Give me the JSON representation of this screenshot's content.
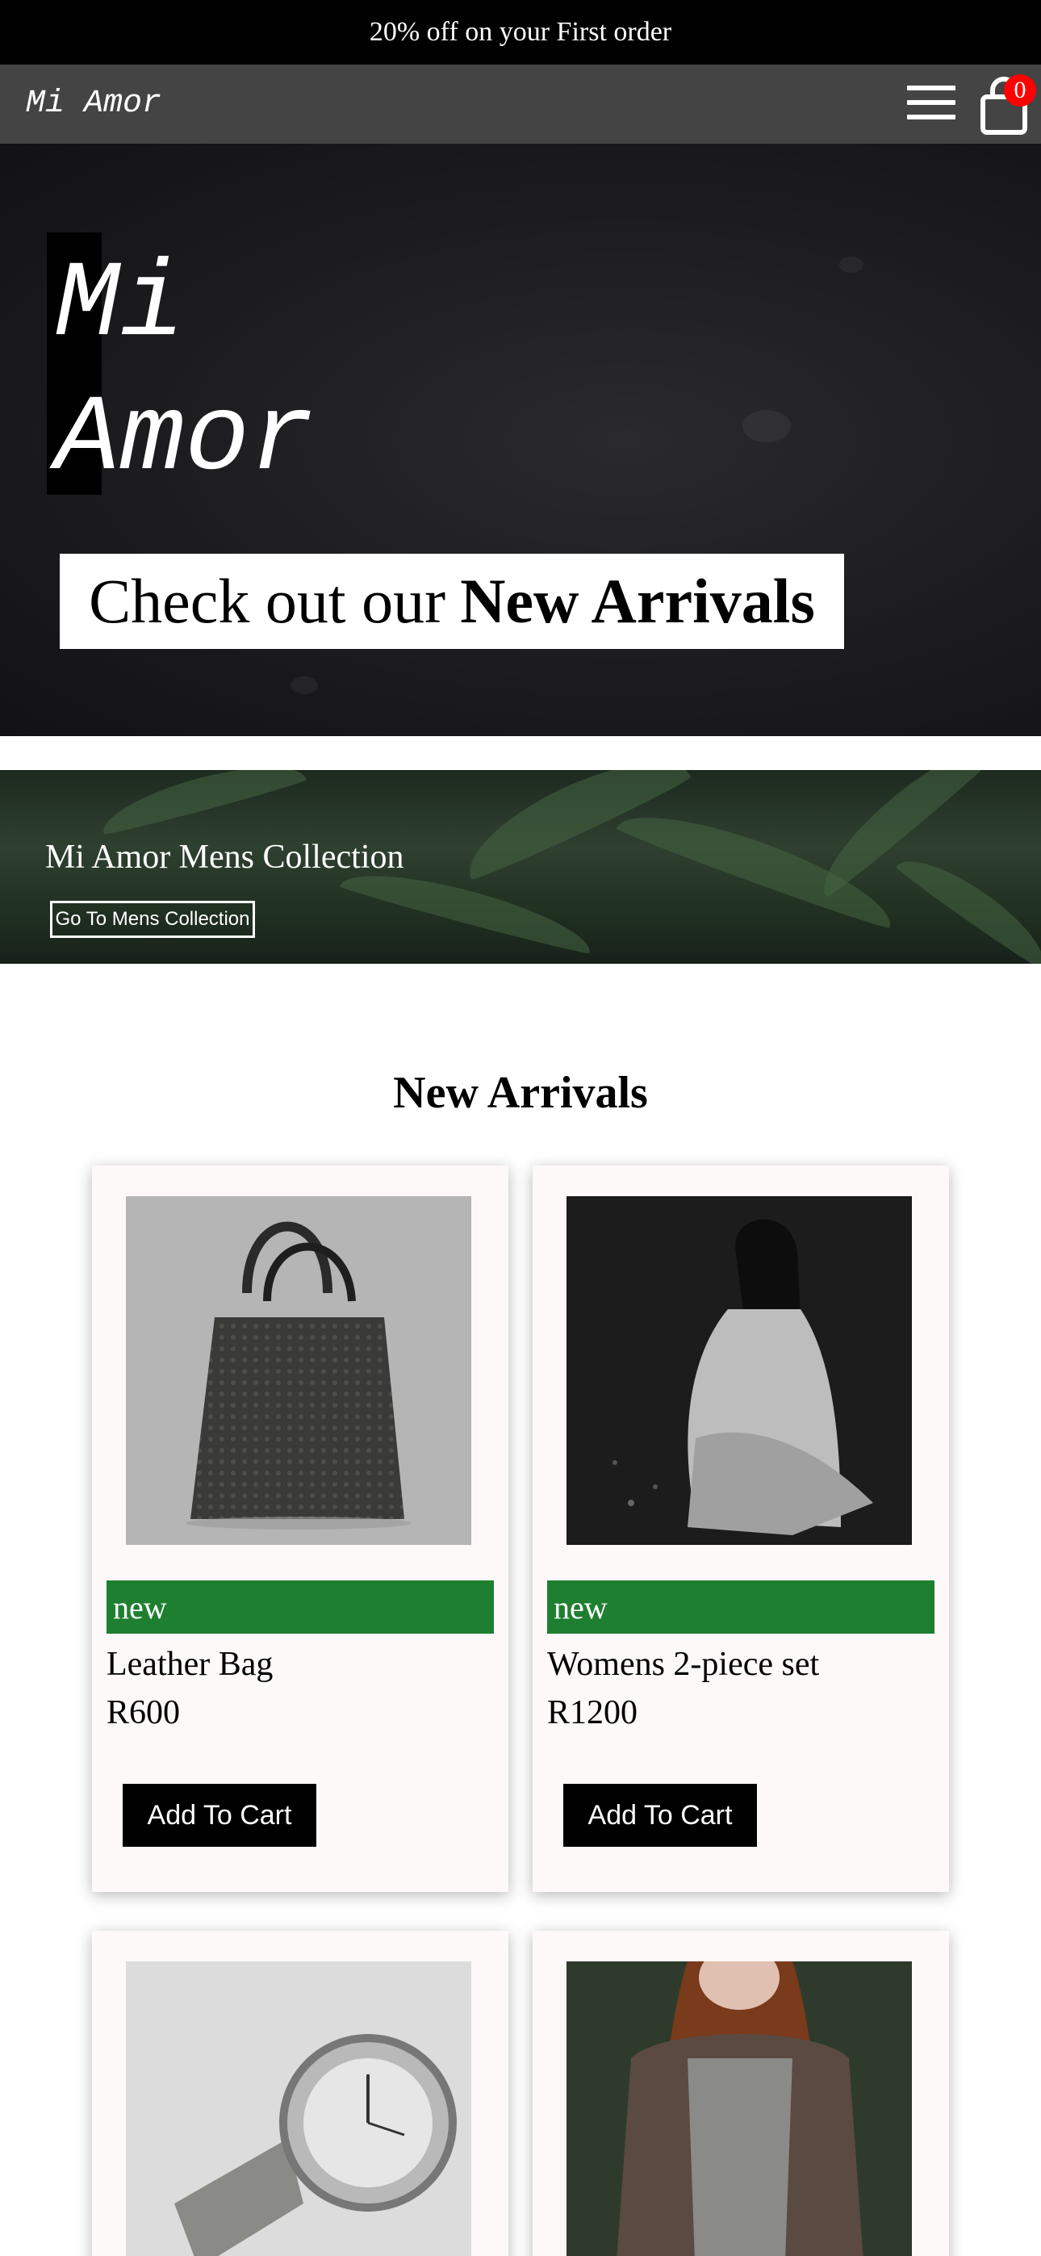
{
  "promo": {
    "text": "20% off on your First order"
  },
  "navbar": {
    "brand": "Mi Amor",
    "cart_count": "0",
    "icons": {
      "menu": "hamburger-menu-icon",
      "cart": "shopping-bag-icon"
    }
  },
  "hero": {
    "title": "Mi\nAmor",
    "cta_prefix": "Check out our",
    "cta_bold": "New Arrivals"
  },
  "mens": {
    "title": "Mi Amor Mens Collection",
    "button_label": "Go To Mens Collection"
  },
  "new_arrivals": {
    "title": "New Arrivals",
    "products": [
      {
        "badge": "new",
        "name": "Leather Bag",
        "price": "R600",
        "button": "Add To Cart",
        "image": "leather-bag-photo"
      },
      {
        "badge": "new",
        "name": "Womens 2-piece set",
        "price": "R1200",
        "button": "Add To Cart",
        "image": "woman-in-silk-set-photo"
      },
      {
        "image": "silver-watch-photo"
      },
      {
        "image": "woman-in-knit-cardigan-photo"
      }
    ]
  },
  "colors": {
    "badge_green": "#1f7f30",
    "cart_badge_red": "#ff0000",
    "nav_gray": "#444444"
  }
}
